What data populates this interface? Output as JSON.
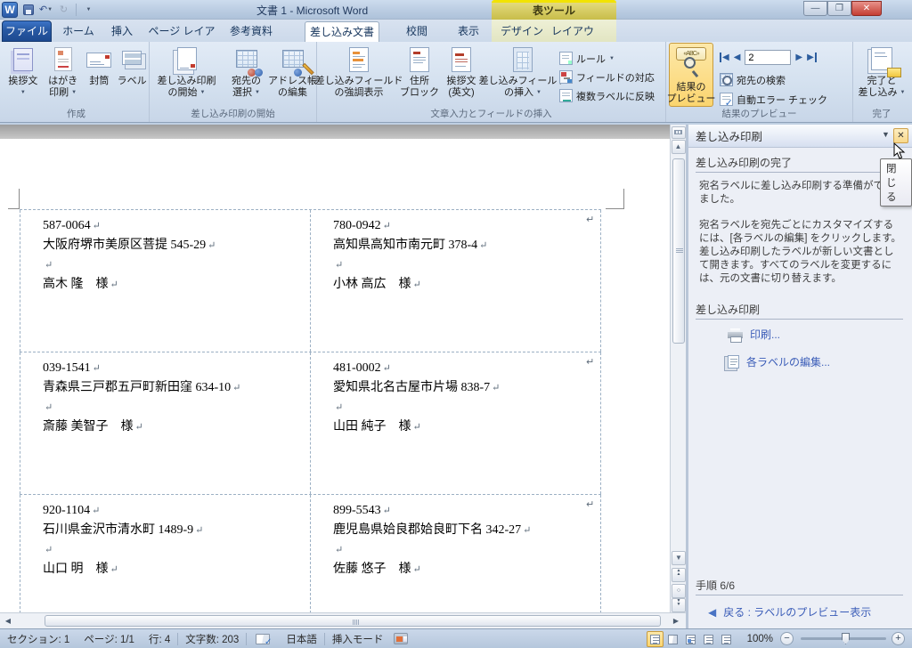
{
  "titlebar": {
    "title": "文書 1 - Microsoft Word",
    "context_header": "表ツール"
  },
  "tabs": {
    "file": "ファイル",
    "home": "ホーム",
    "insert": "挿入",
    "page_layout": "ページ レイアウト",
    "references": "参考資料",
    "mailings": "差し込み文書",
    "review": "校閲",
    "view": "表示",
    "design": "デザイン",
    "layout": "レイアウト"
  },
  "ribbon": {
    "groups": {
      "create": "作成",
      "start_mail_merge": "差し込み印刷の開始",
      "write_insert_fields": "文章入力とフィールドの挿入",
      "preview_results": "結果のプレビュー",
      "finish": "完了"
    },
    "buttons": {
      "greeting": {
        "l1": "挨拶文",
        "l2": ""
      },
      "hagaki": {
        "l1": "はがき",
        "l2": "印刷"
      },
      "envelope": {
        "l1": "封筒"
      },
      "labels": {
        "l1": "ラベル"
      },
      "start_merge": {
        "l1": "差し込み印刷",
        "l2": "の開始"
      },
      "select_recipients": {
        "l1": "宛先の",
        "l2": "選択"
      },
      "edit_recipients": {
        "l1": "アドレス帳",
        "l2": "の編集"
      },
      "highlight_fields": {
        "l1": "差し込みフィールド",
        "l2": "の強調表示"
      },
      "address_block": {
        "l1": "住所",
        "l2": "ブロック"
      },
      "greeting_line": {
        "l1": "挨拶文",
        "l2": "(英文)"
      },
      "insert_field": {
        "l1": "差し込みフィールド",
        "l2": "の挿入"
      },
      "rules": "ルール",
      "match_fields": "フィールドの対応",
      "update_labels": "複数ラベルに反映",
      "preview_results": {
        "l1": "結果の",
        "l2": "プレビュー"
      },
      "find_recipient": "宛先の検索",
      "auto_check": "自動エラー チェック",
      "finish_merge": {
        "l1": "完了と",
        "l2": "差し込み"
      }
    },
    "record_number": "2"
  },
  "document": {
    "labels": [
      {
        "postal": "587-0064",
        "address": "大阪府堺市美原区菩提 545-29",
        "name": "高木 隆　様"
      },
      {
        "postal": "780-0942",
        "address": "高知県高知市南元町 378-4",
        "name": "小林 高広　様"
      },
      {
        "postal": "039-1541",
        "address": "青森県三戸郡五戸町新田窪 634-10",
        "name": "斎藤 美智子　様"
      },
      {
        "postal": "481-0002",
        "address": "愛知県北名古屋市片場 838-7",
        "name": "山田 純子　様"
      },
      {
        "postal": "920-1104",
        "address": "石川県金沢市清水町 1489-9",
        "name": "山口 明　様"
      },
      {
        "postal": "899-5543",
        "address": "鹿児島県姶良郡姶良町下名 342-27",
        "name": "佐藤 悠子　様"
      }
    ]
  },
  "task_pane": {
    "title": "差し込み印刷",
    "close_tooltip": "閉じる",
    "section_complete": "差し込み印刷の完了",
    "p1": "宛名ラベルに差し込み印刷する準備ができました。",
    "p2": "宛名ラベルを宛先ごとにカスタマイズするには、[各ラベルの編集] をクリックします。差し込み印刷したラベルが新しい文書として開きます。すべてのラベルを変更するには、元の文書に切り替えます。",
    "section_merge": "差し込み印刷",
    "link_print": "印刷...",
    "link_edit_labels": "各ラベルの編集...",
    "step": "手順 6/6",
    "back_link": "戻る : ラベルのプレビュー表示"
  },
  "status_bar": {
    "section": "セクション: 1",
    "page": "ページ: 1/1",
    "line": "行: 4",
    "chars": "文字数: 203",
    "language": "日本語",
    "mode": "挿入モード",
    "zoom": "100%"
  }
}
